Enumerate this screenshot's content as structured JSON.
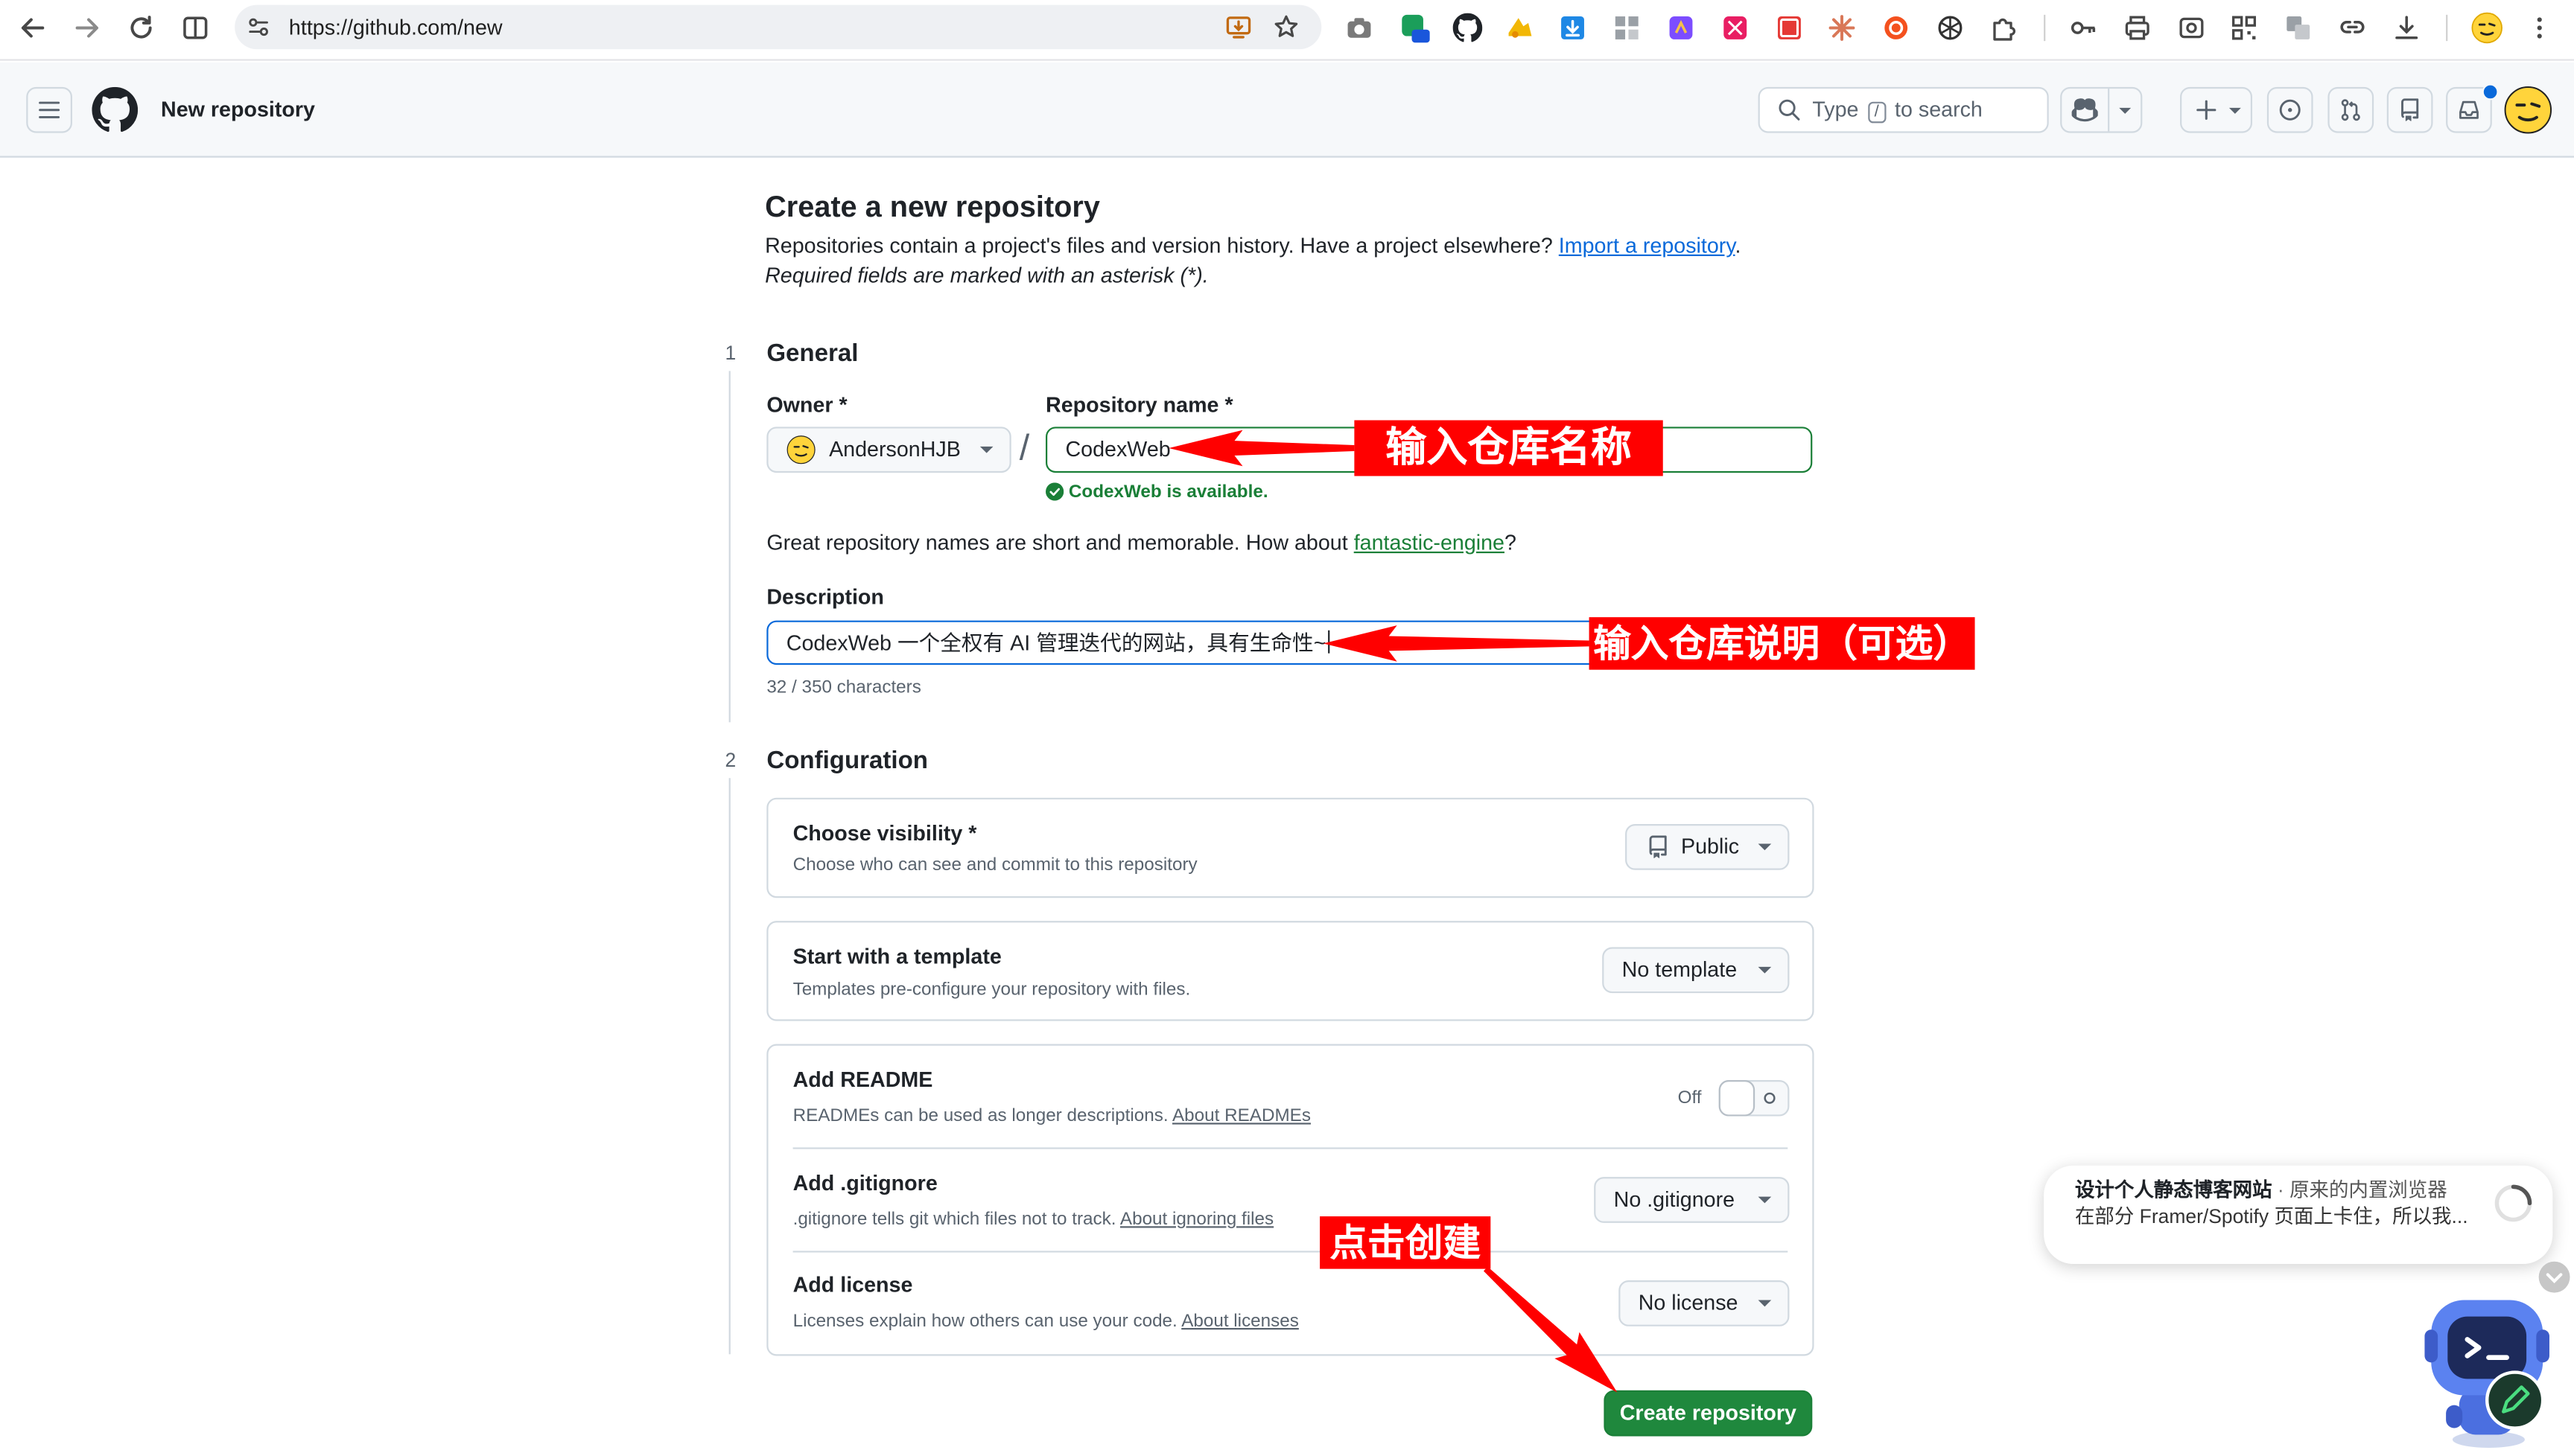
{
  "browser": {
    "url": "https://github.com/new",
    "extensions": [
      "camera-icon",
      "translate-on-icon",
      "github-icon",
      "yellow-extension-icon",
      "blue-download-icon",
      "grid-extension-icon",
      "purple-extension-icon",
      "pink-extension-icon",
      "fe-extension-icon",
      "claude-icon",
      "red-circle-icon",
      "openai-icon",
      "puzzle-icon",
      "key-icon",
      "print-icon",
      "screenshot-icon",
      "qr-icon",
      "translate-icon",
      "link-icon",
      "download-icon",
      "profile-avatar-icon",
      "menu-dots-icon"
    ]
  },
  "header": {
    "title": "New repository",
    "search": {
      "prefix": "Type",
      "key": "/",
      "suffix": "to search"
    }
  },
  "page": {
    "title": "Create a new repository",
    "subtitle": "Repositories contain a project's files and version history. Have a project elsewhere?",
    "import_link": "Import a repository",
    "subtitle_end": ".",
    "required_note": "Required fields are marked with an asterisk (*)."
  },
  "general": {
    "step": "1",
    "heading": "General",
    "owner_label": "Owner *",
    "owner_value": "AndersonHJB",
    "separator": "/",
    "repo_label": "Repository name *",
    "repo_value": "CodexWeb",
    "available": "CodexWeb is available.",
    "hint": "Great repository names are short and memorable. How about",
    "suggestion": "fantastic-engine",
    "hint_end": "?",
    "description_label": "Description",
    "description_value": "CodexWeb 一个全权有 AI 管理迭代的网站，具有生命性~",
    "char_count": "32 / 350 characters"
  },
  "configuration": {
    "step": "2",
    "heading": "Configuration",
    "visibility": {
      "title": "Choose visibility *",
      "description": "Choose who can see and commit to this repository",
      "value": "Public"
    },
    "template": {
      "title": "Start with a template",
      "description": "Templates pre-configure your repository with files.",
      "value": "No template"
    },
    "readme": {
      "title": "Add README",
      "description": "READMEs can be used as longer descriptions.",
      "link": "About READMEs",
      "toggle_state": "Off"
    },
    "gitignore": {
      "title": "Add .gitignore",
      "description": ".gitignore tells git which files not to track.",
      "link": "About ignoring files",
      "value": "No .gitignore"
    },
    "license": {
      "title": "Add license",
      "description": "Licenses explain how others can use your code.",
      "link": "About licenses",
      "value": "No license"
    }
  },
  "create_button": "Create repository",
  "annotations": {
    "repo_name": "输入仓库名称",
    "description": "输入仓库说明（可选）",
    "create": "点击创建"
  },
  "notification": {
    "title": "设计个人静态博客网站",
    "separator": "·",
    "subtitle": "原来的内置浏览器",
    "body": "在部分 Framer/Spotify 页面上卡住，所以我..."
  },
  "colors": {
    "link": "#0969da",
    "success": "#1a7f37",
    "primary_button": "#1f883d",
    "annotation": "#ff0000",
    "focus_border": "#0969da",
    "header_bg": "#f6f8fa"
  }
}
